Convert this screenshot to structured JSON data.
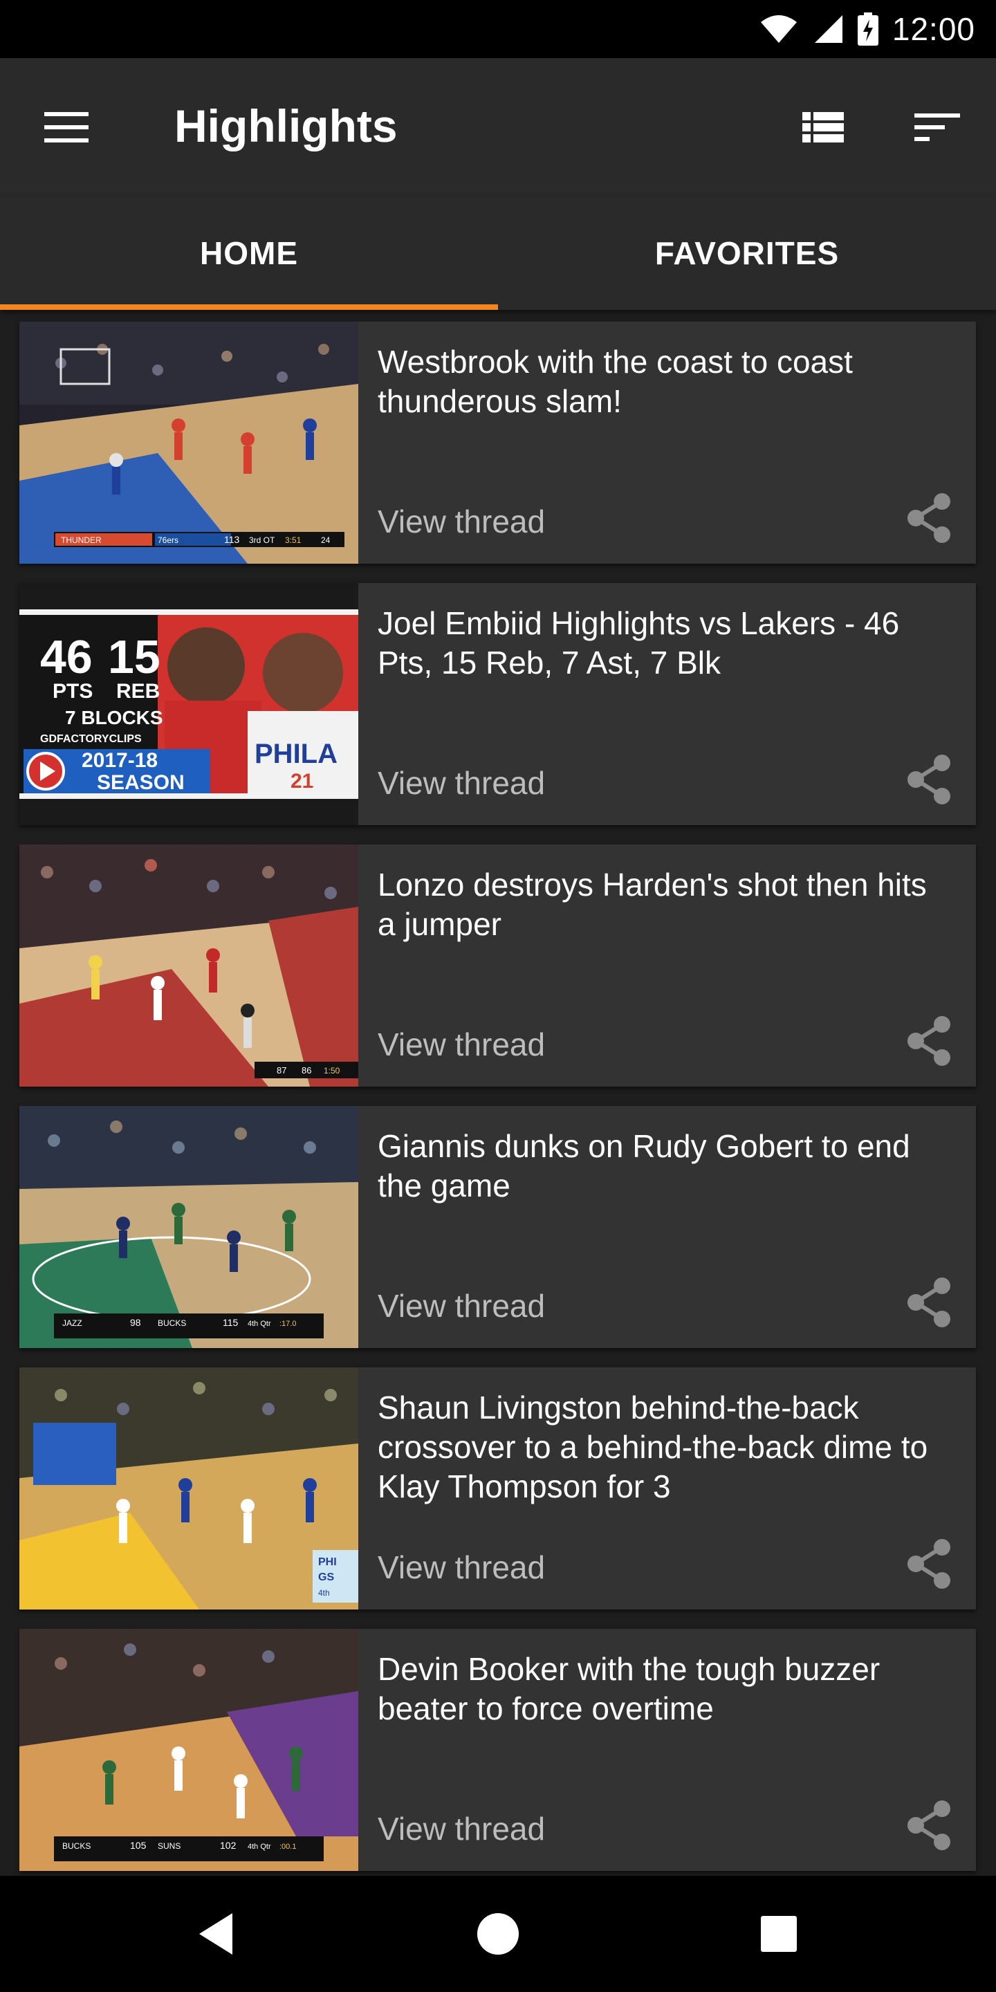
{
  "status_bar": {
    "time": "12:00"
  },
  "app_bar": {
    "title": "Highlights"
  },
  "tabs": [
    {
      "label": "HOME",
      "selected": true
    },
    {
      "label": "FAVORITES",
      "selected": false
    }
  ],
  "accent_color": "#f5861f",
  "posts": [
    {
      "title": "Westbrook with the coast to coast thunderous slam!",
      "action": "View thread",
      "thumb": {
        "court": "#c9a574",
        "paint": "#2f5fb5",
        "crowd": "#2d2d3a",
        "scorebar": [
          "THUNDER",
          "76ers",
          "113",
          "3rd OT",
          "3:51",
          "24"
        ]
      }
    },
    {
      "title": "Joel Embiid Highlights vs Lakers - 46 Pts, 15 Reb, 7 Ast, 7 Blk",
      "action": "View thread",
      "thumb": {
        "stat1": "46",
        "stat1_label": "PTS",
        "stat2": "15",
        "stat2_label": "REB",
        "stat3": "7 BLOCKS",
        "channel": "GDFACTORYCLIPS",
        "season_line1": "2017-18",
        "season_line2": "SEASON",
        "jersey": "PHILA",
        "number": "21"
      }
    },
    {
      "title": "Lonzo destroys Harden's shot then hits a jumper",
      "action": "View thread",
      "thumb": {
        "court": "#b23a34",
        "floor": "#d9b58a",
        "crowd": "#3a2b2e",
        "scorebar": [
          "87",
          "86",
          "1:50"
        ]
      }
    },
    {
      "title": "Giannis dunks on Rudy Gobert to end the game",
      "action": "View thread",
      "thumb": {
        "court": "#c7a97e",
        "paint": "#2c7a58",
        "crowd": "#2b3344",
        "scorebar": [
          "JAZZ",
          "98",
          "BUCKS",
          "115",
          "4th Qtr",
          ":17.0"
        ]
      }
    },
    {
      "title": "Shaun Livingston behind-the-back crossover to a behind-the-back dime to Klay Thompson for 3",
      "action": "View thread",
      "thumb": {
        "court": "#d3a85a",
        "paint": "#f2c230",
        "crowd": "#3b3a2d",
        "scorebar": [
          "PHI",
          "GS",
          "4th"
        ]
      }
    },
    {
      "title": "Devin Booker with the tough buzzer beater to force overtime",
      "action": "View thread",
      "thumb": {
        "court": "#d59a55",
        "paint": "#6a3d8f",
        "crowd": "#3a2f2a",
        "scorebar": [
          "BUCKS",
          "105",
          "SUNS",
          "102",
          "4th Qtr",
          ":00.1"
        ]
      }
    }
  ]
}
